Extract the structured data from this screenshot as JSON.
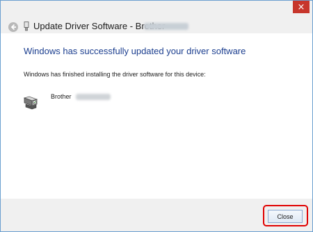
{
  "window": {
    "title": "Update Driver Software - Brother",
    "close_glyph": "×"
  },
  "content": {
    "heading": "Windows has successfully updated your driver software",
    "subtext": "Windows has finished installing the driver software for this device:",
    "device_name": "Brother"
  },
  "footer": {
    "close_label": "Close"
  },
  "colors": {
    "heading": "#1b3e8f",
    "close_x_bg": "#c7362c",
    "highlight": "#e00000",
    "window_border": "#6a9fd0"
  },
  "icons": {
    "back": "back-arrow-icon",
    "title_device": "usb-device-icon",
    "device": "printer-icon",
    "close": "close-icon"
  }
}
